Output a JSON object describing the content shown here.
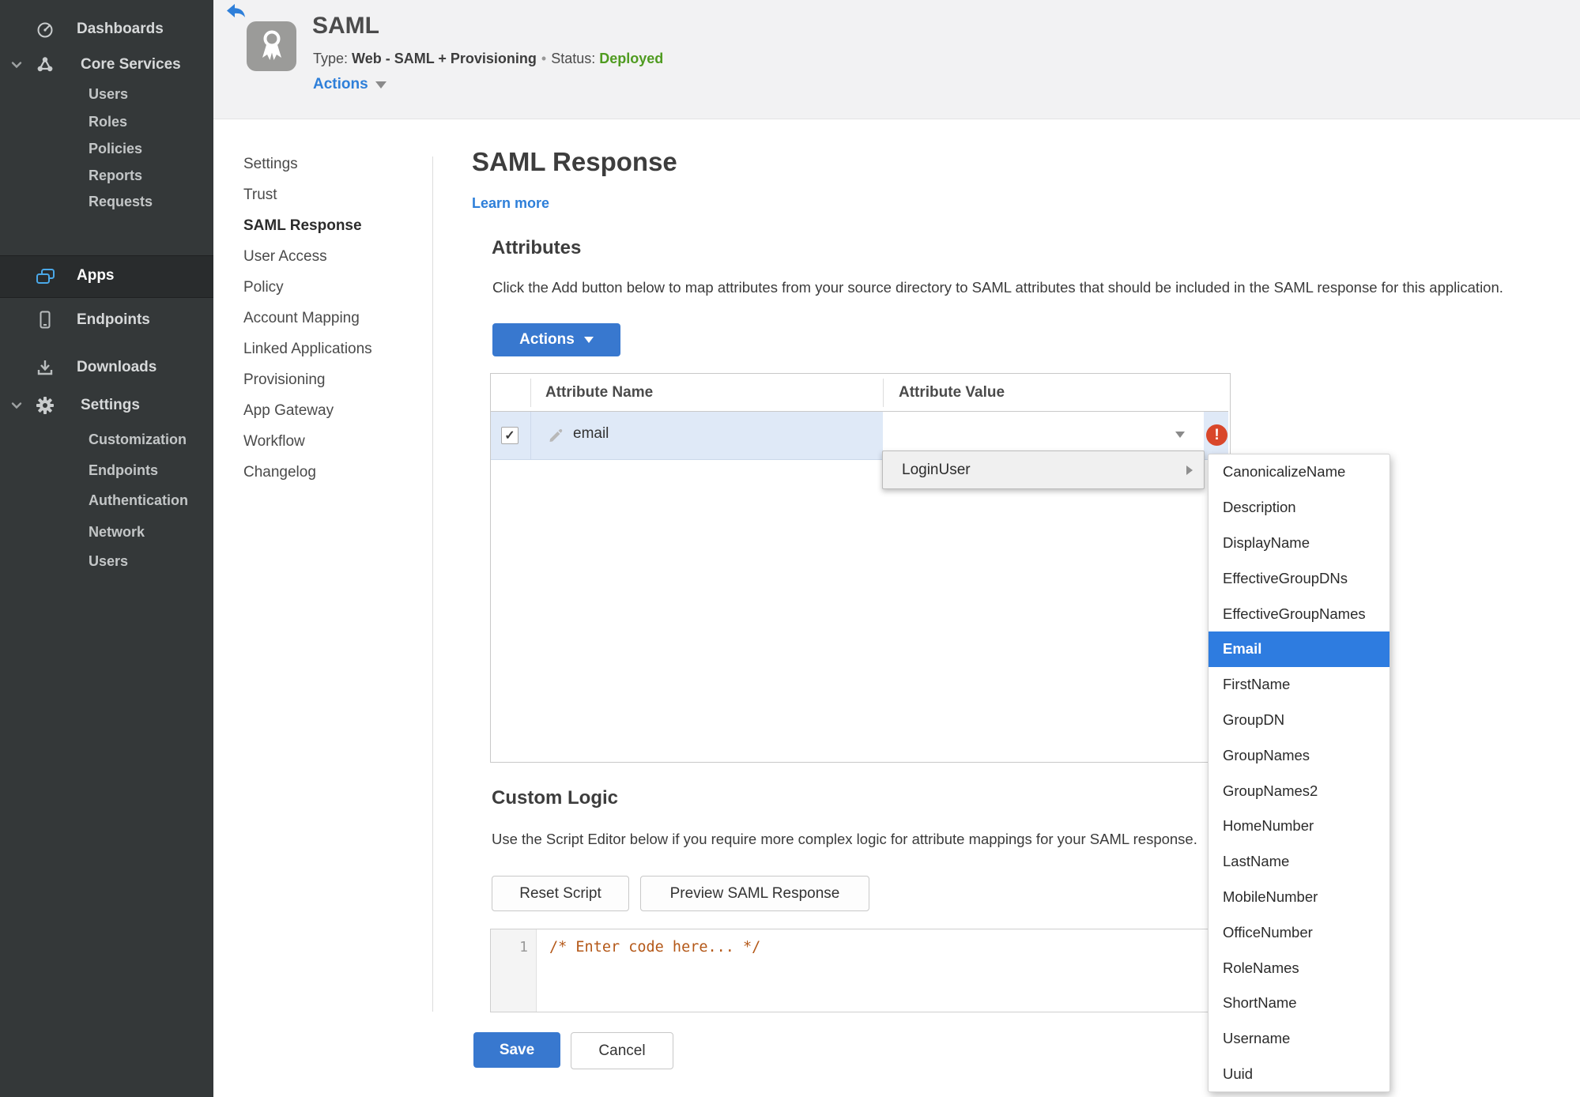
{
  "sidebar": {
    "items": [
      {
        "label": "Dashboards",
        "icon": "gauge-icon"
      },
      {
        "label": "Core Services",
        "icon": "core-services-icon",
        "expanded": true,
        "children": [
          "Users",
          "Roles",
          "Policies",
          "Reports",
          "Requests"
        ]
      },
      {
        "label": "Apps",
        "icon": "apps-icon",
        "active": true
      },
      {
        "label": "Endpoints",
        "icon": "endpoint-icon"
      },
      {
        "label": "Downloads",
        "icon": "download-icon"
      },
      {
        "label": "Settings",
        "icon": "gear-icon",
        "expanded": true,
        "children": [
          "Customization",
          "Endpoints",
          "Authentication",
          "Network",
          "Users"
        ]
      }
    ]
  },
  "header": {
    "app_title": "SAML",
    "type_label": "Type:",
    "type_value": "Web - SAML + Provisioning",
    "separator": "•",
    "status_label": "Status:",
    "status_value": "Deployed",
    "actions_label": "Actions"
  },
  "subnav": {
    "active_item": "SAML Response",
    "items": [
      "Settings",
      "Trust",
      "SAML Response",
      "User Access",
      "Policy",
      "Account Mapping",
      "Linked Applications",
      "Provisioning",
      "App Gateway",
      "Workflow",
      "Changelog"
    ]
  },
  "main": {
    "title": "SAML Response",
    "learn_more": "Learn more",
    "attributes": {
      "heading": "Attributes",
      "description": "Click the Add button below to map attributes from your source directory to SAML attributes that should be included in the SAML response for this application.",
      "actions_button": "Actions",
      "table": {
        "columns": [
          "Attribute Name",
          "Attribute Value"
        ],
        "rows": [
          {
            "checked": "✓",
            "name": "email",
            "value": "",
            "error": "!"
          }
        ]
      }
    },
    "custom_logic": {
      "heading": "Custom Logic",
      "description": "Use the Script Editor below if you require more complex logic for attribute mappings for your SAML response.",
      "reset_button": "Reset Script",
      "preview_button": "Preview SAML Response",
      "editor": {
        "line_number": "1",
        "code": "/* Enter code here... */"
      }
    },
    "save_button": "Save",
    "cancel_button": "Cancel"
  },
  "value_menu": {
    "parent_item": "LoginUser",
    "selected_option": "Email",
    "options": [
      "CanonicalizeName",
      "Description",
      "DisplayName",
      "EffectiveGroupDNs",
      "EffectiveGroupNames",
      "Email",
      "FirstName",
      "GroupDN",
      "GroupNames",
      "GroupNames2",
      "HomeNumber",
      "LastName",
      "MobileNumber",
      "OfficeNumber",
      "RoleNames",
      "ShortName",
      "Username",
      "Uuid"
    ]
  },
  "colors": {
    "accent_blue": "#3878cf",
    "link_blue": "#2e7fd9",
    "menu_selected_blue": "#2e7ce0",
    "status_green": "#4f9b20",
    "error_red": "#d9472b",
    "sidebar_bg": "#343839",
    "row_highlight": "#dfe9f7",
    "code_text": "#b45818"
  }
}
